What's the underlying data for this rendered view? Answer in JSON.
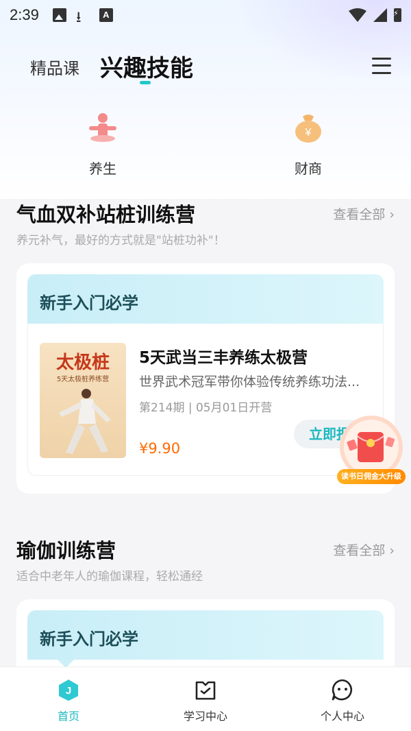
{
  "status_bar": {
    "time": "2:39",
    "a_icon_letter": "A"
  },
  "header": {
    "tab_jingpin": "精品课",
    "tab_xingqu": "兴趣技能"
  },
  "categories": [
    {
      "label": "养生",
      "icon": "meditation-icon"
    },
    {
      "label": "财商",
      "icon": "money-bag-icon"
    }
  ],
  "sections": [
    {
      "title": "气血双补站桩训练营",
      "subtitle": "养元补气，最好的方式就是\"站桩功补\"！",
      "more_label": "查看全部 ›",
      "banner": "新手入门必学",
      "course": {
        "thumb_title": "太极桩",
        "thumb_sub": "5天太极桩养练营",
        "title": "5天武当三丰养练太极营",
        "desc": "世界武术冠军带你体验传统养练功法...",
        "meta": "第214期 | 05月01日开营",
        "price": "¥9.90",
        "button": "立即报名"
      }
    },
    {
      "title": "瑜伽训练营",
      "subtitle": "适合中老年人的瑜伽课程，轻松通经",
      "more_label": "查看全部 ›",
      "banner": "新手入门必学"
    }
  ],
  "promo": {
    "label": "读书日佣金大升级"
  },
  "bottom_nav": [
    {
      "label": "首页",
      "icon": "home-icon",
      "badge": "J"
    },
    {
      "label": "学习中心",
      "icon": "study-icon"
    },
    {
      "label": "个人中心",
      "icon": "profile-icon"
    }
  ],
  "colors": {
    "accent": "#1bb8c0",
    "price": "#ff6a00",
    "banner_text": "#1d4f5a"
  }
}
